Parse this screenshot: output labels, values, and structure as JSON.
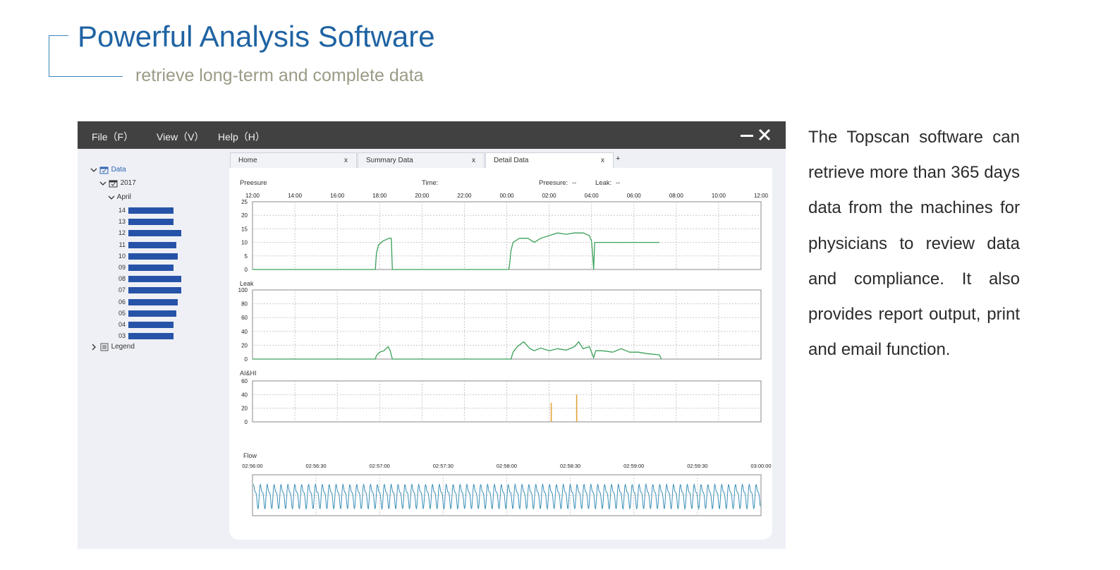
{
  "header": {
    "title": "Powerful Analysis Software",
    "subtitle": "retrieve long-term and complete data"
  },
  "description": "The Topscan software can retrieve more than 365 days data from the machines for physicians to review data and compliance. It also provides report output, print and email function.",
  "app": {
    "menu": [
      "File（F）",
      "View（V）",
      "Help（H）"
    ],
    "tree": {
      "root": "Data",
      "year": "2017",
      "month": "April",
      "days": [
        {
          "label": "14",
          "value": 0.58
        },
        {
          "label": "13",
          "value": 0.58
        },
        {
          "label": "12",
          "value": 0.68
        },
        {
          "label": "11",
          "value": 0.62
        },
        {
          "label": "10",
          "value": 0.64
        },
        {
          "label": "09",
          "value": 0.58
        },
        {
          "label": "08",
          "value": 0.68
        },
        {
          "label": "07",
          "value": 0.68
        },
        {
          "label": "06",
          "value": 0.64
        },
        {
          "label": "05",
          "value": 0.62
        },
        {
          "label": "04",
          "value": 0.58
        },
        {
          "label": "03",
          "value": 0.58
        }
      ],
      "legend": "Legend"
    },
    "tabs": [
      {
        "label": "Home",
        "close": "x"
      },
      {
        "label": "Summary Data",
        "close": "x"
      },
      {
        "label": "Detail Data",
        "close": "x",
        "active": true
      }
    ],
    "tab_add": "+",
    "info": {
      "section": "Preesure",
      "time_label": "Time:",
      "pressure_label": "Preesure:",
      "pressure_value": "--",
      "leak_label": "Leak:",
      "leak_value": "--"
    },
    "colors": {
      "line": "#3aa15a",
      "event": "#e3a43a",
      "flow": "#3a8fb8",
      "bar": "#2653a8"
    }
  },
  "chart_data": [
    {
      "type": "line",
      "name": "pressure",
      "title": "",
      "ylabel": "",
      "x_ticks": [
        "12:00",
        "14:00",
        "16:00",
        "18:00",
        "20:00",
        "22:00",
        "00:00",
        "02:00",
        "04:00",
        "06:00",
        "08:00",
        "10:00",
        "12:00"
      ],
      "y_ticks": [
        "25",
        "20",
        "15",
        "10",
        "5",
        "0"
      ],
      "ylim": [
        0,
        25
      ],
      "xlim": [
        0,
        24
      ],
      "series": [
        {
          "x": [
            0,
            5.8,
            5.85,
            5.95,
            6.15,
            6.45,
            6.55,
            6.6,
            6.62,
            12.1,
            12.15,
            12.2,
            12.3,
            12.6,
            13.0,
            13.3,
            13.6,
            14.0,
            14.4,
            14.8,
            15.2,
            15.6,
            15.9,
            16.0,
            16.05,
            16.1,
            16.15,
            16.2,
            19.2
          ],
          "y": [
            0,
            0,
            6,
            9,
            10.5,
            11.5,
            11.5,
            0,
            0,
            0,
            3,
            7,
            10,
            11.5,
            11.5,
            10,
            11.5,
            12.5,
            13.5,
            13,
            13.5,
            13.5,
            12.5,
            10.5,
            6,
            0,
            10,
            10,
            10
          ]
        }
      ]
    },
    {
      "type": "line",
      "name": "leak",
      "title": "Leak",
      "y_ticks": [
        "100",
        "80",
        "60",
        "40",
        "20",
        "0"
      ],
      "ylim": [
        0,
        100
      ],
      "xlim": [
        0,
        24
      ],
      "series": [
        {
          "x": [
            0,
            5.8,
            5.85,
            6.0,
            6.2,
            6.4,
            6.5,
            6.6,
            6.65,
            12.2,
            12.3,
            12.5,
            12.8,
            13.1,
            13.3,
            13.6,
            14.0,
            14.4,
            14.8,
            15.2,
            15.4,
            15.6,
            15.9,
            16.1,
            16.2,
            16.5,
            17.0,
            17.4,
            17.8,
            18.2,
            18.6,
            19.2,
            19.3
          ],
          "y": [
            0,
            0,
            5,
            10,
            12,
            18,
            12,
            0,
            0,
            0,
            10,
            18,
            25,
            15,
            12,
            16,
            12,
            15,
            13,
            18,
            25,
            15,
            18,
            2,
            12,
            12,
            10,
            15,
            10,
            10,
            8,
            6,
            0
          ]
        }
      ]
    },
    {
      "type": "bar",
      "name": "events",
      "title": "AI&HI",
      "y_ticks": [
        "60",
        "40",
        "20",
        "0"
      ],
      "ylim": [
        0,
        60
      ],
      "xlim": [
        0,
        24
      ],
      "events": [
        {
          "x": 14.1,
          "y": 28
        },
        {
          "x": 15.3,
          "y": 40
        }
      ]
    },
    {
      "type": "line",
      "name": "flow",
      "title": "Flow",
      "x_ticks": [
        "02:56:00",
        "02:56:30",
        "02:57:00",
        "02:57:30",
        "02:58:00",
        "02:58:30",
        "02:59:00",
        "02:59:30",
        "03:00:00"
      ],
      "ylim": [
        -1,
        1
      ],
      "xlim": [
        0,
        240
      ],
      "breath_period_s": 3.25
    }
  ]
}
